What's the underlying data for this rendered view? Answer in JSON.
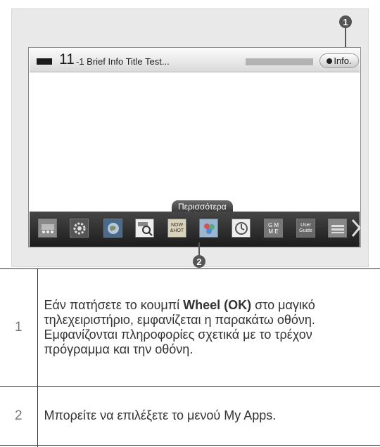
{
  "screen": {
    "channel_number": "11",
    "channel_title": "-1 Brief Info Title Test...",
    "info_button_label": "Info.",
    "more_tab_label": "Περισσότερα",
    "progress_fraction": 0.0
  },
  "dock_icons": [
    "input-icon",
    "settings-icon",
    "internet-icon",
    "search-icon",
    "now-and-hot-icon",
    "premium-icon",
    "time-machine-icon",
    "game-world-icon",
    "user-guide-icon",
    "my-apps-list-icon"
  ],
  "dock_glyphs": {
    "search": "Search",
    "now_hot": "NOW\n&HOT",
    "game_world": "G M\nM E",
    "user_guide": "User\nGuide"
  },
  "callouts": {
    "badge1": "1",
    "badge2": "2"
  },
  "table": {
    "rows": [
      {
        "number": "1",
        "text_pre": "Εάν πατήσετε το κουμπί ",
        "text_bold": "Wheel (OK)",
        "text_post": " στο μαγικό τηλεχειριστήριο, εμφανίζεται η παρακάτω οθόνη.",
        "text_line2": "Εμφανίζονται πληροφορίες σχετικά με το τρέχον πρόγραμμα και την οθόνη."
      },
      {
        "number": "2",
        "text": "Μπορείτε να επιλέξετε το μενού My Apps."
      }
    ]
  }
}
